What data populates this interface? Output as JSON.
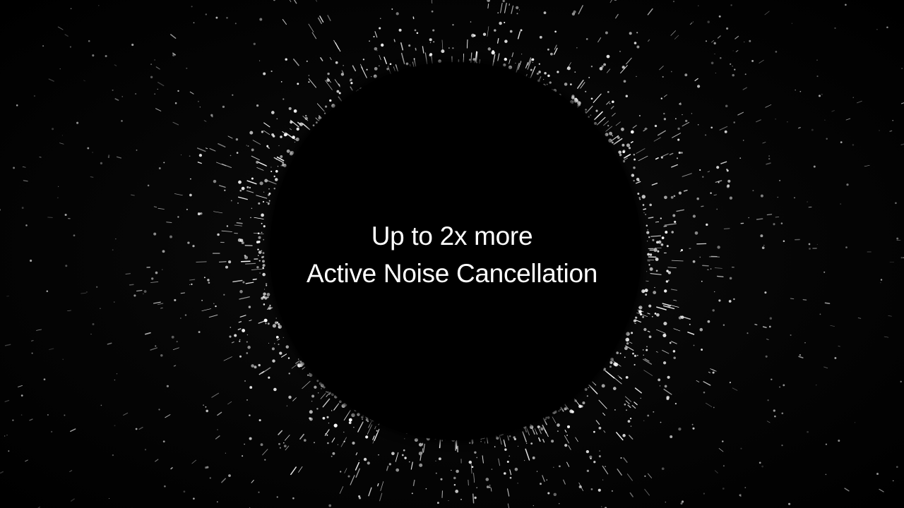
{
  "headline": {
    "line1": "Up to 2x more",
    "line2": "Active Noise Cancellation"
  },
  "colors": {
    "background": "#000000",
    "text": "#ffffff",
    "particles": "#ffffff"
  }
}
